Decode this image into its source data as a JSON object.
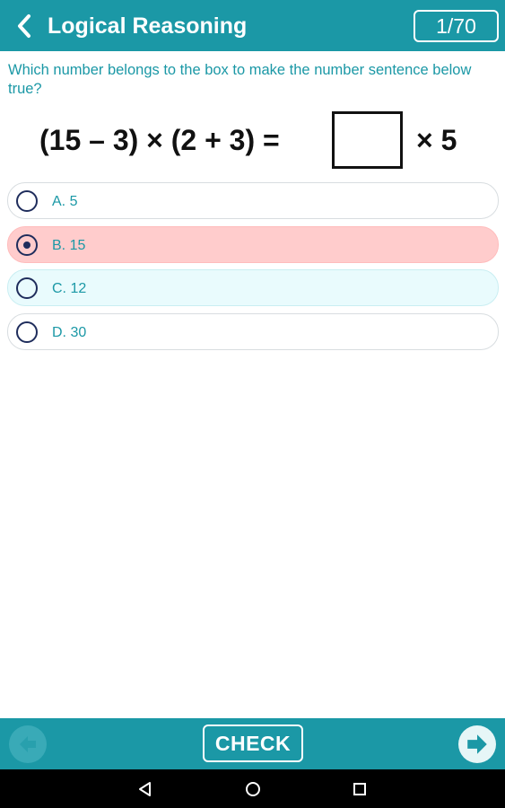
{
  "header": {
    "title": "Logical Reasoning",
    "counter": "1/70",
    "back_icon": "chevron-left-icon"
  },
  "question": {
    "text": "Which number belongs to the box to make the number sentence below true?",
    "equation_left": "(15 – 3) × (2 + 3) =",
    "equation_right": "× 5"
  },
  "options": [
    {
      "label": "A. 5",
      "state": "unselected"
    },
    {
      "label": "B. 15",
      "state": "selected"
    },
    {
      "label": "C. 12",
      "state": "highlighted"
    },
    {
      "label": "D. 30",
      "state": "unselected"
    }
  ],
  "footer": {
    "check_label": "CHECK",
    "prev_icon": "arrow-left-icon",
    "next_icon": "arrow-right-icon"
  },
  "system_nav": {
    "back_icon": "triangle-back-icon",
    "home_icon": "circle-home-icon",
    "recents_icon": "square-recents-icon"
  },
  "colors": {
    "primary": "#1b98a6",
    "selected_bg": "#ffcccc",
    "highlight_bg": "#e9fbfd",
    "radio": "#1f2d5c"
  }
}
